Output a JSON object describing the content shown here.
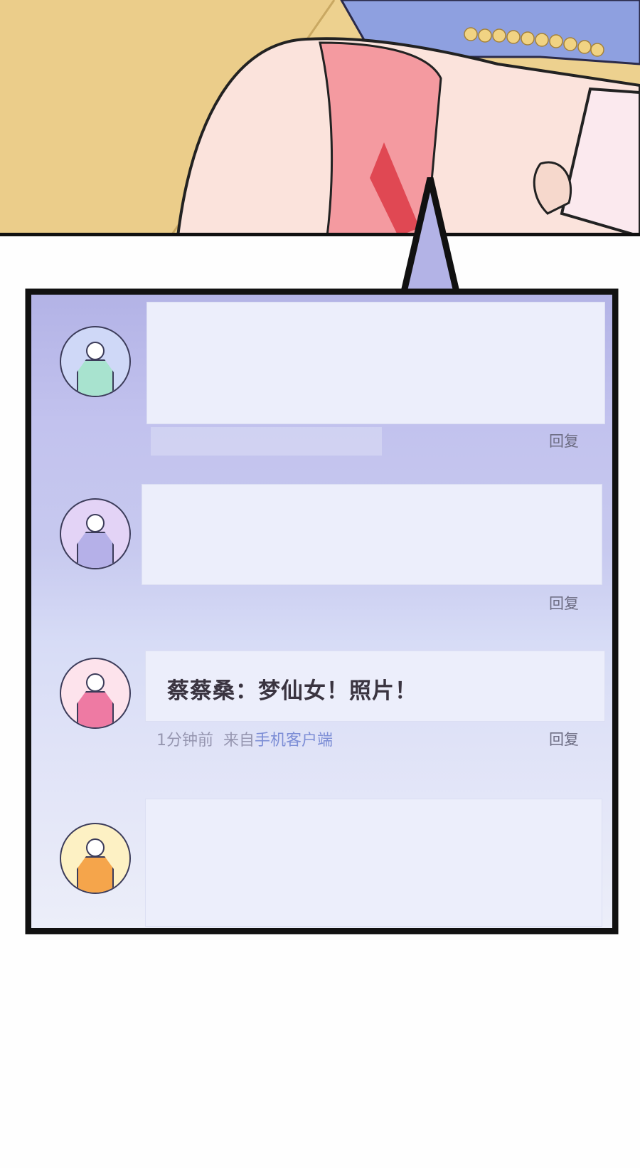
{
  "comments": [
    {
      "avatar_color": "#a8e3cf",
      "avatar_bg": "#cfd8f7",
      "text": "",
      "meta_time": "",
      "meta_source_prefix": "",
      "meta_source": "",
      "reply_label": "回复"
    },
    {
      "avatar_color": "#b5b0e8",
      "avatar_bg": "#e3d3f6",
      "text": "",
      "meta_time": "",
      "meta_source_prefix": "",
      "meta_source": "",
      "reply_label": "回复"
    },
    {
      "avatar_color": "#ee7aa3",
      "avatar_bg": "#fde3ec",
      "text": "蔡蔡桑：梦仙女！照片！",
      "meta_time": "1分钟前",
      "meta_source_prefix": "来自",
      "meta_source": "手机客户端",
      "reply_label": "回复"
    },
    {
      "avatar_color": "#f5a54b",
      "avatar_bg": "#fdf1c4",
      "text": "",
      "meta_time": "",
      "meta_source_prefix": "",
      "meta_source": "",
      "reply_label": ""
    }
  ],
  "colors": {
    "panel_border": "#111111",
    "screen_top": "#b3b3e6",
    "screen_bottom": "#eceef9",
    "bubble": "#eceefb"
  }
}
